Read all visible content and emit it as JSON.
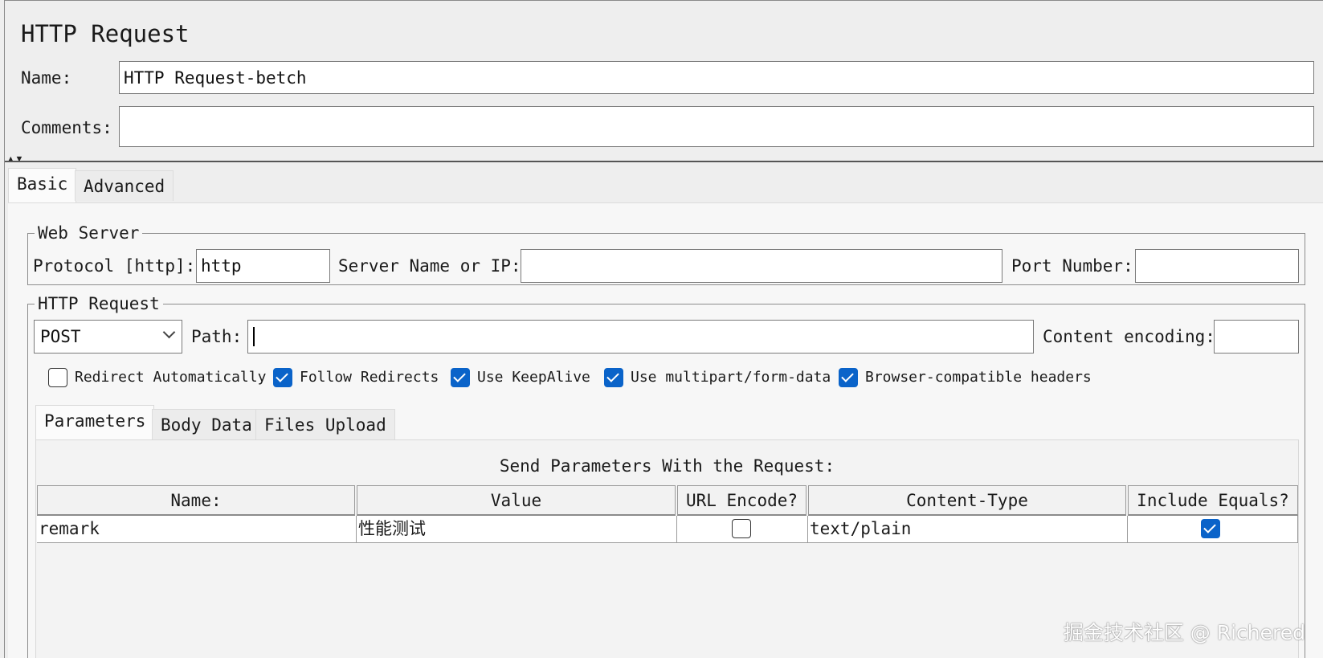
{
  "panel": {
    "title": "HTTP Request",
    "name_label": "Name:",
    "name_value": "HTTP Request-betch",
    "comments_label": "Comments:",
    "comments_value": ""
  },
  "tabs": [
    {
      "label": "Basic",
      "active": true
    },
    {
      "label": "Advanced",
      "active": false
    }
  ],
  "web_server": {
    "legend": "Web Server",
    "protocol_label": "Protocol [http]:",
    "protocol_value": "http",
    "server_label": "Server Name or IP:",
    "server_value": "",
    "port_label": "Port Number:",
    "port_value": ""
  },
  "http_request": {
    "legend": "HTTP Request",
    "method": "POST",
    "path_label": "Path:",
    "path_value": "",
    "encoding_label": "Content encoding:",
    "encoding_value": "",
    "options": [
      {
        "label": "Redirect Automatically",
        "checked": false
      },
      {
        "label": "Follow Redirects",
        "checked": true
      },
      {
        "label": "Use KeepAlive",
        "checked": true
      },
      {
        "label": "Use multipart/form-data",
        "checked": true
      },
      {
        "label": "Browser-compatible headers",
        "checked": true
      }
    ]
  },
  "sub_tabs": [
    {
      "label": "Parameters",
      "active": true
    },
    {
      "label": "Body Data",
      "active": false
    },
    {
      "label": "Files Upload",
      "active": false
    }
  ],
  "params": {
    "caption": "Send Parameters With the Request:",
    "columns": [
      "Name:",
      "Value",
      "URL Encode?",
      "Content-Type",
      "Include Equals?"
    ],
    "rows": [
      {
        "name": "remark",
        "value": "性能测试",
        "url_encode": false,
        "content_type": "text/plain",
        "include_equals": true
      }
    ]
  },
  "watermark": "掘金技术社区 @ Richered",
  "colors": {
    "accent": "#0a63c9",
    "background": "#eeeeee",
    "field": "#ffffff"
  }
}
